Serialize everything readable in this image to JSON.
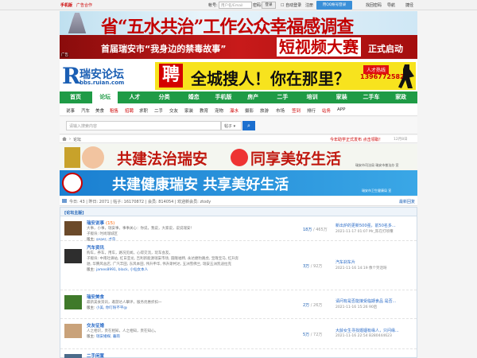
{
  "topbar": {
    "mobile": "手机版",
    "ad_cooperation": "广告合作",
    "account_label": "帐号:",
    "username_placeholder": "用户名/Email",
    "password_label": "密码:",
    "login": "登录",
    "auto_login": "自动登录",
    "register": "注册",
    "qq_login": "用QQ帐号登录",
    "forgot_password": "找回密码",
    "navigation": "导航",
    "quick": "捷径"
  },
  "banners": {
    "survey": "省“五水共治”工作公众幸福感调查",
    "contest_prefix": "首届瑞安市“我身边的禁毒故事”",
    "contest_main": "短视频大赛",
    "contest_suffix": "正式启动",
    "ad_tag": "广告"
  },
  "logo": {
    "letter": "R",
    "name": "瑞安论坛",
    "url": "bbs.ruian.com"
  },
  "recruit": {
    "char": "聘",
    "slogan": "全城搜人！你在那里？",
    "hotline_label": "人才热线",
    "phone": "13967725820"
  },
  "main_nav": [
    "首页",
    "论坛",
    "人才",
    "分类",
    "婚恋",
    "手机版",
    "房产",
    "二手",
    "培训",
    "家装",
    "二手车",
    "家政"
  ],
  "main_nav_active": 1,
  "sub_nav": [
    "说事",
    "汽车",
    "美食",
    "租售",
    "招聘",
    "求职",
    "二手",
    "交友",
    "家装",
    "教育",
    "宠物",
    "瀑水",
    "摄影",
    "旅游",
    "市场",
    "签到",
    "排行",
    "站务",
    "APP"
  ],
  "search": {
    "placeholder": "请输入搜索内容",
    "type": "帖子",
    "button_icon": "search-icon"
  },
  "breadcrumb": {
    "item": "论坛",
    "notice": "今年助学正式发布 点击领取！",
    "date": "12月8日"
  },
  "slogans": {
    "line1_a": "共建法治瑞安",
    "line1_b": "同享美好生活",
    "line1_org": "瑞安市司法局 瑞安市普法办 宣",
    "line2": "共建健康瑞安  共享美好生活",
    "line2_org": "瑞安市卫生健康局 宣"
  },
  "stats": {
    "text": "今日: 43 | 昨日: 2071 | 帖子: 16170872 | 会员: 814054 | 欢迎新会员: ztody",
    "latest": "最新回复"
  },
  "forum": {
    "section_title": "[论坛主版]",
    "rows": [
      {
        "name": "瑞安说事",
        "today": "(15)",
        "desc": [
          "大事，小事，瑞安事，事事关心：你说，我说，大家说，说说瑞安！",
          "子版块: 时尚瑞城区"
        ],
        "moderator_label": "版主:",
        "moderators": "seaer, 才鸟",
        "count_main": "18万",
        "count_sub": "/ 465万",
        "last_post": "新出炉的更新500强，前50名多...",
        "last_time": "2021-11-17 01:07 Mr_陈在打喷嚏"
      },
      {
        "name": "汽车资讯",
        "today": "",
        "desc": [
          "购车，养车，用车，路况见闻，心得交流，玩车会友。",
          "子版块: 中南社驿站, 红日亚龙, 吉利新能源瑞安市场, 圆隆福特, 永达捷豹路虎, 宝隆宝马, 红升奔",
          "驰, 华腾风总店, 广汽丰田, 东风本田, 伟升申华, 伟升斯柯达, 五洲雪佛兰, 瑞安五洲凯迪拉克"
        ],
        "moderator_label": "版主:",
        "moderators": "james8991, black, 小仙女本人",
        "count_main": "3万",
        "count_sub": "/ 92万",
        "last_post": "汽车刹车片",
        "last_time": "2021-11-16 14:19 像个笑话呀"
      },
      {
        "name": "瑞安美食",
        "today": "",
        "desc": [
          "最新美食资讯，邀游达人攀评，服务优惠折扣一"
        ],
        "moderator_label": "版主:",
        "moderators": "小美, 你叮粉不平@",
        "count_main": "2万",
        "count_sub": "/ 26万",
        "last_post": "请问有是否能接受临期食品 是否...",
        "last_time": "2021-11-16 15:26 90后"
      },
      {
        "name": "交友征婚",
        "today": "",
        "desc": [
          "人之相识，贵在相知，人之相知，贵在知心。"
        ],
        "moderator_label": "版主:",
        "moderators": "瑞安婚媒, 暮雨",
        "count_main": "5万",
        "count_sub": "/ 72万",
        "last_post": "大龄女生寻找婚姻有缘人，只问缘...",
        "last_time": "2021-11-16 22:54 B280444623"
      },
      {
        "name": "二手闲置",
        "today": "",
        "desc": [],
        "moderator_label": "",
        "moderators": "",
        "count_main": "",
        "count_sub": "",
        "last_post": "",
        "last_time": ""
      }
    ]
  },
  "colors": {
    "nav_green": "#1f9b46",
    "link_blue": "#2a6bc7",
    "accent_red": "#c00000"
  }
}
